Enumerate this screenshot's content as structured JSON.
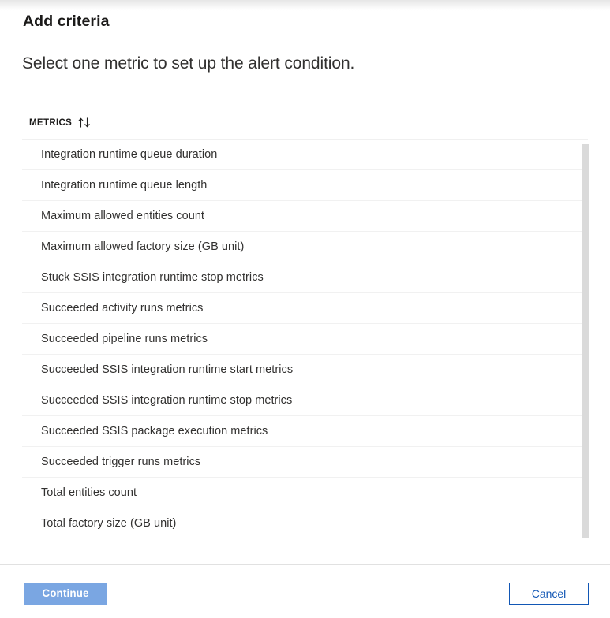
{
  "blade": {
    "title": "Add criteria",
    "subtitle": "Select one metric to set up the alert condition."
  },
  "list": {
    "column_header": "METRICS",
    "sort_icon": "sort-ascending-descending-icon",
    "items": [
      {
        "label": "Integration runtime queue duration"
      },
      {
        "label": "Integration runtime queue length"
      },
      {
        "label": "Maximum allowed entities count"
      },
      {
        "label": "Maximum allowed factory size (GB unit)"
      },
      {
        "label": "Stuck SSIS integration runtime stop metrics"
      },
      {
        "label": "Succeeded activity runs metrics"
      },
      {
        "label": "Succeeded pipeline runs metrics"
      },
      {
        "label": "Succeeded SSIS integration runtime start metrics"
      },
      {
        "label": "Succeeded SSIS integration runtime stop metrics"
      },
      {
        "label": "Succeeded SSIS package execution metrics"
      },
      {
        "label": "Succeeded trigger runs metrics"
      },
      {
        "label": "Total entities count"
      },
      {
        "label": "Total factory size (GB unit)"
      }
    ]
  },
  "footer": {
    "continue_label": "Continue",
    "cancel_label": "Cancel"
  },
  "colors": {
    "continue_background": "#7aa6e2",
    "continue_text": "#ffffff",
    "cancel_border": "#1257b5",
    "cancel_text": "#1257b5",
    "row_divider": "#f1f1f1",
    "scrollbar_thumb": "#dadada",
    "text_primary": "#323130"
  }
}
